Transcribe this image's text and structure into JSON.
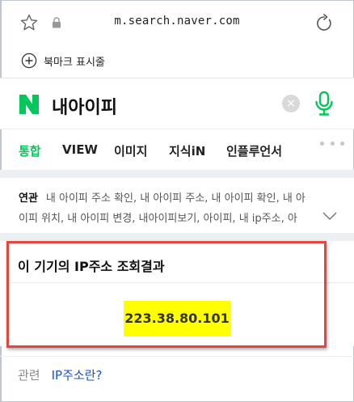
{
  "browser": {
    "url": "m.search.naver.com",
    "bookmark_label": "북마크 표시줄"
  },
  "search": {
    "logo_letter": "N",
    "query": "내아이피"
  },
  "tabs": [
    {
      "label": "통합",
      "active": true
    },
    {
      "label": "VIEW",
      "active": false
    },
    {
      "label": "이미지",
      "active": false
    },
    {
      "label": "지식iN",
      "active": false
    },
    {
      "label": "인플루언서",
      "active": false
    }
  ],
  "related": {
    "label": "연관",
    "line1": "내 아이피 주소 확인, 내 아이피 주소, 내 아이피 확인, 내 아",
    "line2": "이피 위치, 내 아이피 변경, 내아이피보기, 아이피, 내 ip주소, 아"
  },
  "ip_card": {
    "title": "이 기기의 IP주소 조회결과",
    "ip_address": "223.38.80.101"
  },
  "footer": {
    "label": "관련",
    "link": "IP주소란?"
  },
  "colors": {
    "naver_green": "#03c75a",
    "highlight": "#ffff00",
    "annotation_red": "#e2463f",
    "link_blue": "#1a55c7"
  }
}
